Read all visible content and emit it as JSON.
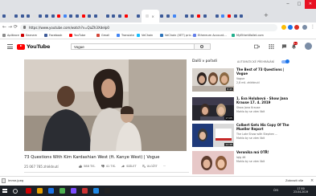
{
  "browser": {
    "address_url": "https://www.youtube.com/watch?v=QaZh3XdeIp0",
    "colors": {
      "tab_strip": "#dfe1e5",
      "close_button": "#e81123"
    },
    "tab_favicon_colors": [
      "#3b5998",
      "#e0e0e0",
      "#3b5998",
      "#3b5998",
      "#3b5998",
      "#e0e0e0",
      "#3b5998",
      "#3b5998",
      "#3b5998",
      "#ff0000",
      "#4285f4",
      "#3b5998",
      "#3b5998",
      "#ff0000",
      "#3b5998",
      "#3b5998",
      "#e0e0e0",
      "#3b5998",
      "#3b5998",
      "#3b5998",
      "#ff0000",
      "#e0e0e0",
      "#3b5998",
      "#e0e0e0",
      "#3b5998",
      "#3b5998",
      "#4285f4",
      "#e0e0e0",
      "#3b5998",
      "#3b5998",
      "#ff0000",
      "#3b5998",
      "#e0e0e0",
      "#3b5998",
      "#4285f4",
      "#ff0000",
      "#3b5998",
      "#3b5998",
      "#e0e0e0"
    ]
  },
  "bookmarks": [
    {
      "label": "Aplikace",
      "color": "#8a8a8a"
    },
    {
      "label": "Seznam",
      "color": "#cc0000"
    },
    {
      "label": "Facebook",
      "color": "#3b5998"
    },
    {
      "label": "YouTube",
      "color": "#ff0000"
    },
    {
      "label": "Gmail",
      "color": "#d44638"
    },
    {
      "label": "Translate",
      "color": "#4285f4"
    },
    {
      "label": "VeChain",
      "color": "#15bdff"
    },
    {
      "label": "VeChain (VET) pric...",
      "color": "#2a71b8"
    },
    {
      "label": "Ethereum Account...",
      "color": "#627eea"
    },
    {
      "label": "MyEtherWallet.com",
      "color": "#1fae8b"
    }
  ],
  "youtube": {
    "logo_text": "YouTube",
    "search_value": "Vogue",
    "notification_count": "9+",
    "video": {
      "title": "73 Questions With Kim Kardashian West (ft. Kanye West) | Vogue",
      "views": "25 067 785 zhlédnutí",
      "likes": "588 TIS.",
      "dislikes": "41 TIS.",
      "share_label": "SDÍLET",
      "save_label": "ULOŽIT"
    },
    "sidebar": {
      "up_next": "Další v pořadí",
      "autoplay": "AUTOMATICKÉ PŘEHRÁVÁNÍ",
      "autoplay_on": true,
      "items": [
        {
          "title": "The Best of 73 Questions | Vogue",
          "channel": "Vogue",
          "meta": "2,8 mil. zhlédnutí",
          "duration": "8:45"
        },
        {
          "title": "1. Eva Holubová - Show Jana Krause 17. 4. 2019",
          "channel": "Show Jana Krause",
          "meta": "Mohlo by se vám líbit",
          "duration": "17:05"
        },
        {
          "title": "Colbert Gets His Copy Of The Mueller Report",
          "channel": "The Late Show with Stephen ...",
          "meta": "Mohlo by se vám líbit",
          "duration": "12:38"
        },
        {
          "title": "Veronika má OTŘ!",
          "channel": "Iqlg 46",
          "meta": "Mohlo by se vám líbit",
          "duration": ""
        }
      ]
    }
  },
  "downloads": {
    "file_label": "Imme.jpeg",
    "show_all": "Zobrazit vše",
    "close_glyph": "×"
  },
  "taskbar": {
    "tray_lang": "ČES",
    "time": "17:50",
    "date": "23.04.2019",
    "app_colors": [
      "#cc0000",
      "#e6a000",
      "#1a73e8",
      "#4caf50",
      "#7c4dff",
      "#cc3333",
      "#1e88e5",
      "#222222"
    ]
  }
}
